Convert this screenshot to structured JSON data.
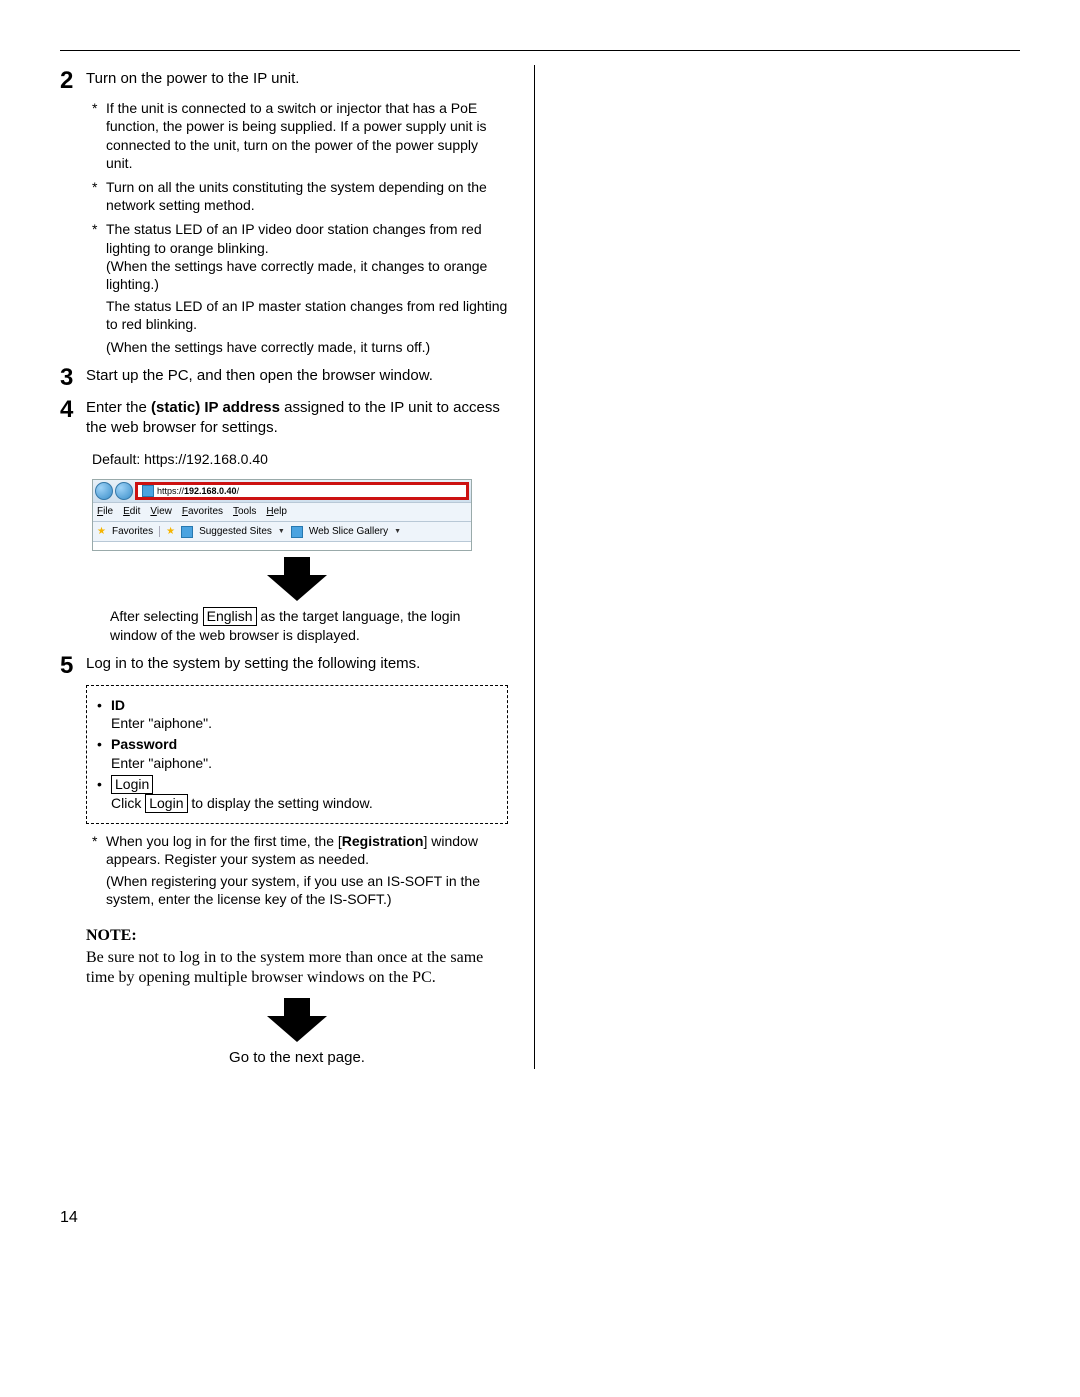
{
  "page_number": "14",
  "steps": {
    "s2": {
      "num": "2",
      "title": "Turn on the power to the IP unit.",
      "sub1": "If the unit is connected to a switch or injector that has a PoE function, the power is being supplied. If a power supply unit is connected to the unit, turn on the power of the power supply unit.",
      "sub2": "Turn on all the units constituting the system depending on the network setting method.",
      "sub3a": "The status LED of an IP video door station changes from red lighting to orange blinking.",
      "sub3b": "(When the settings have correctly made, it changes to orange lighting.)",
      "cont4a": "The status LED of an IP master station changes from red lighting to red blinking.",
      "cont4b": "(When the settings have correctly made, it turns off.)"
    },
    "s3": {
      "num": "3",
      "title": "Start up the PC, and then open the browser window."
    },
    "s4": {
      "num": "4",
      "title_pre": "Enter the ",
      "title_bold": "static) IP address",
      "title_post": " assigned to the IP unit to access the web browser for settings.",
      "default": "Default: https://192.168.0.40",
      "browser": {
        "url_prefix": "https://",
        "url_host": "192.168.0.40",
        "url_suffix": "/",
        "menu": [
          "File",
          "Edit",
          "View",
          "Favorites",
          "Tools",
          "Help"
        ],
        "fav_label": "Favorites",
        "link1": "Suggested Sites",
        "link2": "Web Slice Gallery"
      },
      "after_pre": "After selecting ",
      "after_lang": "English",
      "after_post": " as the target language, the login window of the web browser is displayed."
    },
    "s5": {
      "num": "5",
      "title": "Log in to the system by setting the following items.",
      "box": {
        "id_label": "ID",
        "id_text": "Enter \"aiphone\".",
        "pw_label": "Password",
        "pw_text": "Enter \"aiphone\".",
        "login_label": "Login",
        "login_pre": "Click ",
        "login_btn": "Login",
        "login_post": " to display the setting window."
      },
      "sub1_pre": "When you log in for the first time, the [",
      "sub1_bold": "Registration",
      "sub1_post": "] window appears. Register your system as needed.",
      "cont2": "(When registering your system, if you use an IS-SOFT in the system, enter the license key of the IS-SOFT.)",
      "note_h": "NOTE:",
      "note_body": "Be sure not to log in to the system more than once at the same time by opening multiple browser windows on the PC.",
      "nextpage": "Go to the next page."
    }
  }
}
